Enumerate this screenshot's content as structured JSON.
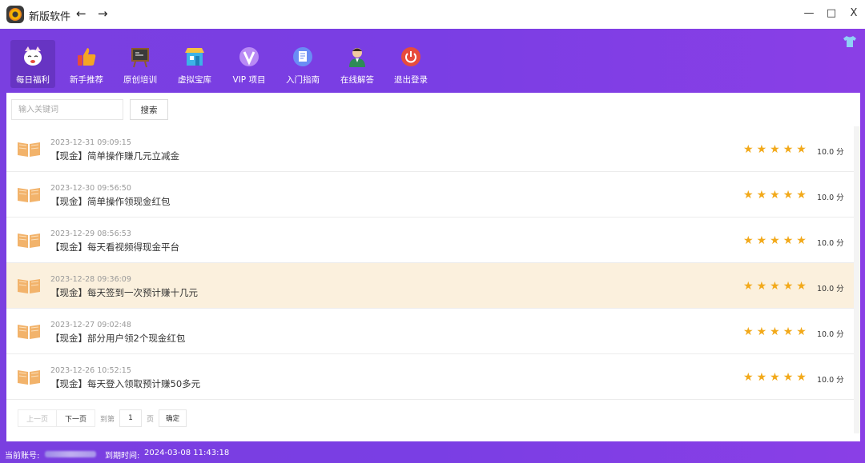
{
  "window": {
    "title": "新版软件",
    "back_glyph": "←",
    "forward_glyph": "→",
    "minimize_glyph": "—",
    "maximize_glyph": "□",
    "close_glyph": "X"
  },
  "toolbar": {
    "items": [
      {
        "label": "每日福利",
        "icon": "cat-mascot-icon",
        "color": "#f4eef7",
        "active": true
      },
      {
        "label": "新手推荐",
        "icon": "thumbs-up-icon",
        "color": "#f5a623"
      },
      {
        "label": "原创培训",
        "icon": "chalkboard-icon",
        "color": "#e6a23c"
      },
      {
        "label": "虚拟宝库",
        "icon": "shop-icon",
        "color": "#3db2e8"
      },
      {
        "label": "VIP 项目",
        "icon": "vip-icon",
        "color": "#a06ef0"
      },
      {
        "label": "入门指南",
        "icon": "document-icon",
        "color": "#5b7cf0"
      },
      {
        "label": "在线解答",
        "icon": "support-agent-icon",
        "color": "#2e8b57"
      },
      {
        "label": "退出登录",
        "icon": "power-icon",
        "color": "#e74c3c"
      }
    ]
  },
  "search": {
    "placeholder": "输入关键词",
    "button_label": "搜索"
  },
  "list": {
    "rows": [
      {
        "date": "2023-12-31 09:09:15",
        "title": "【现金】简单操作赚几元立减金",
        "score": "10.0 分",
        "highlighted": false
      },
      {
        "date": "2023-12-30 09:56:50",
        "title": "【现金】简单操作领现金红包",
        "score": "10.0 分",
        "highlighted": false
      },
      {
        "date": "2023-12-29 08:56:53",
        "title": "【现金】每天看视频得现金平台",
        "score": "10.0 分",
        "highlighted": false
      },
      {
        "date": "2023-12-28 09:36:09",
        "title": "【现金】每天签到一次预计赚十几元",
        "score": "10.0 分",
        "highlighted": true
      },
      {
        "date": "2023-12-27 09:02:48",
        "title": "【现金】部分用户领2个现金红包",
        "score": "10.0 分",
        "highlighted": false
      },
      {
        "date": "2023-12-26 10:52:15",
        "title": "【现金】每天登入领取预计赚50多元",
        "score": "10.0 分",
        "highlighted": false
      }
    ],
    "stars_per_row": 5,
    "star_color": "#f2a91a"
  },
  "pagination": {
    "prev_label": "上一页",
    "next_label": "下一页",
    "goto_label": "到第",
    "page_value": "1",
    "page_suffix": "页",
    "confirm_label": "确定"
  },
  "status": {
    "account_label": "当前账号:",
    "expire_label": "到期时间:",
    "expire_value": "2024-03-08 11:43:18"
  },
  "colors": {
    "purple": "#7a3fe0",
    "highlight_row": "#fbf0dd",
    "star": "#f2a91a"
  }
}
